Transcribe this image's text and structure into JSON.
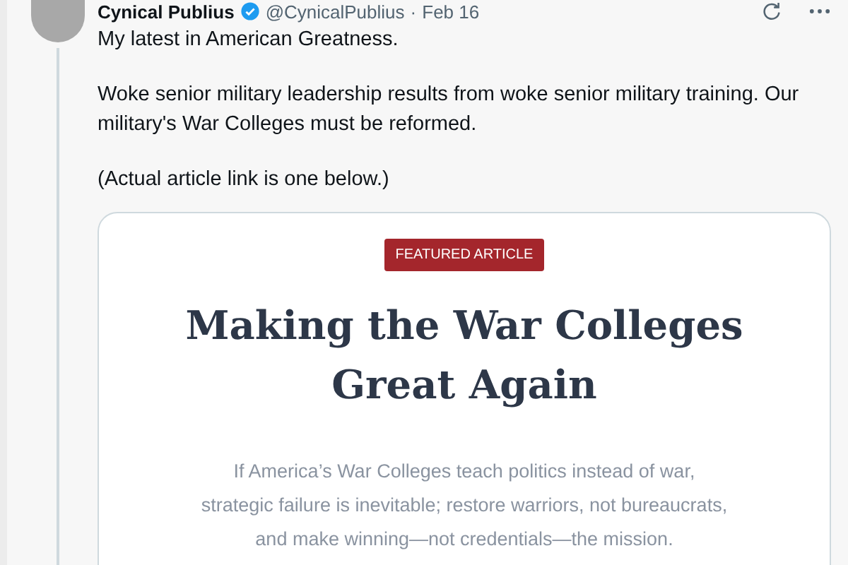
{
  "post": {
    "display_name": "Cynical Publius",
    "verified": true,
    "handle": "@CynicalPublius",
    "separator": "·",
    "date": "Feb 16",
    "paragraphs": [
      "My latest in American Greatness.",
      "Woke senior military leadership results from woke senior military training. Our military's War Colleges must be reformed.",
      "(Actual article link is one below.)"
    ]
  },
  "article_card": {
    "badge": "FEATURED ARTICLE",
    "title": "Making the War Colleges Great Again",
    "summary": "If America’s War Colleges teach politics instead of war, strategic failure is inevitable; restore warriors, not bureaucrats, and make winning—not credentials—the mission."
  }
}
